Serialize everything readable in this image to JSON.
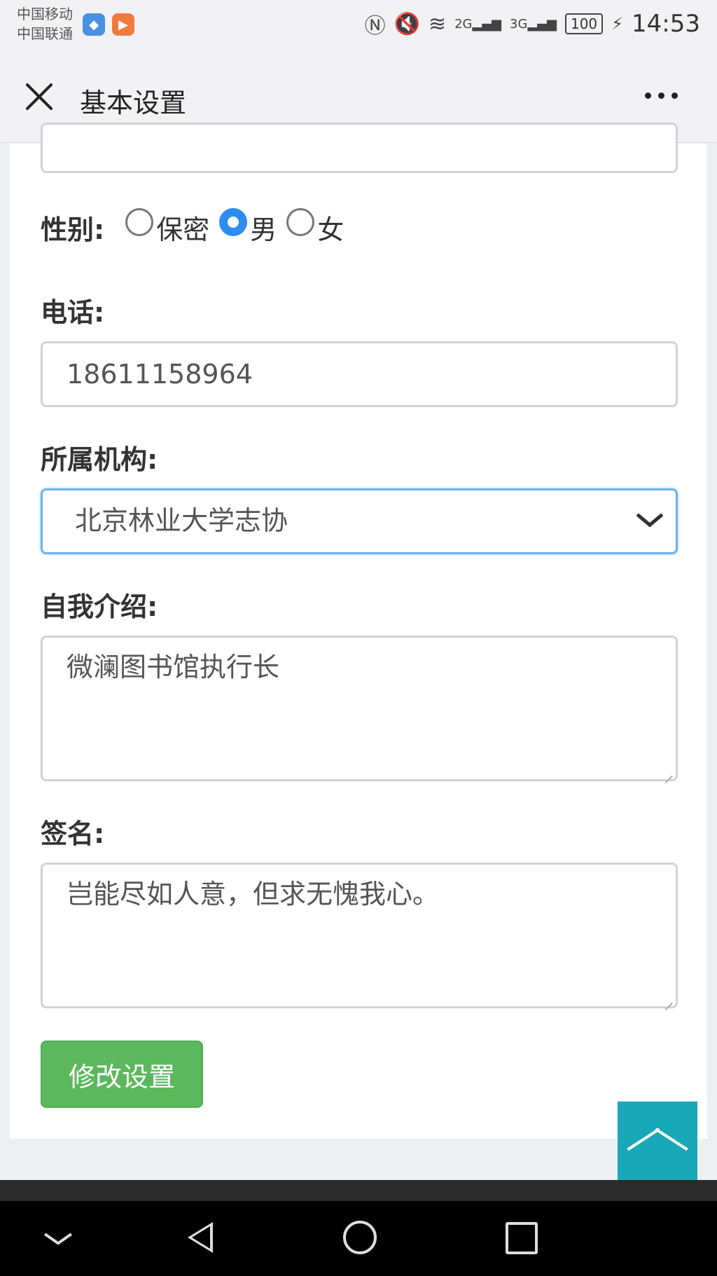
{
  "status_bar": {
    "carrier_1": "中国移动",
    "carrier_2": "中国联通",
    "battery": "100",
    "time": "14:53",
    "net_2g": "2G",
    "net_3g": "3G"
  },
  "header": {
    "title": "基本设置"
  },
  "form": {
    "gender_label": "性别:",
    "gender_options": [
      "保密",
      "男",
      "女"
    ],
    "gender_selected": "男",
    "phone_label": "电话:",
    "phone_value": "18611158964",
    "org_label": "所属机构:",
    "org_value": "北京林业大学志协",
    "intro_label": "自我介绍:",
    "intro_value": "微澜图书馆执行长",
    "signature_label": "签名:",
    "signature_value": "岂能尽如人意，但求无愧我心。",
    "submit_label": "修改设置"
  },
  "colors": {
    "accent": "#2d8cf0",
    "submit": "#5cb85c",
    "scroll_top": "#18a8b8"
  }
}
